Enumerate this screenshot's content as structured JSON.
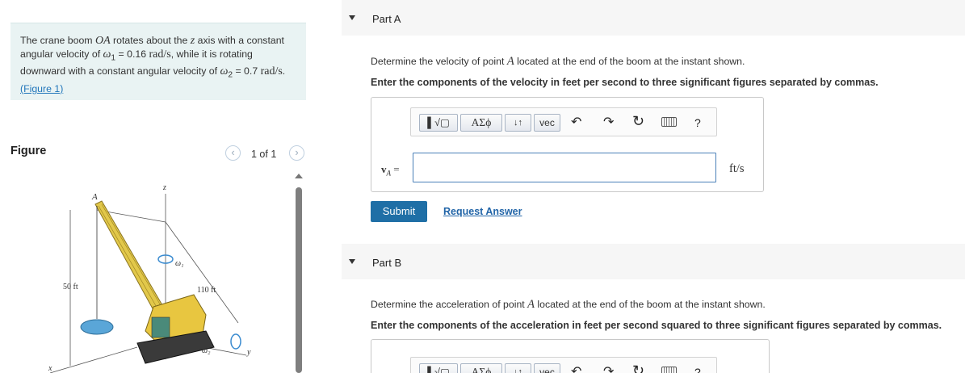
{
  "problem": {
    "text_1": "The crane boom ",
    "boom_var": "OA",
    "text_2": " rotates about the ",
    "axis_var": "z",
    "text_3": " axis with a constant angular velocity of ",
    "omega1_sym": "ω",
    "omega1_sub": "1",
    "omega1_eq": " = 0.16 ",
    "unit_1": "rad/s",
    "text_4": ", while it is rotating downward with a constant angular velocity of ",
    "omega2_sym": "ω",
    "omega2_sub": "2",
    "omega2_eq": " = 0.7 ",
    "unit_2": "rad/s",
    "text_5": ". ",
    "figure_link": "(Figure 1)"
  },
  "figure": {
    "title": "Figure",
    "pager": "1 of 1",
    "prev_icon": "chevron-left-icon",
    "next_icon": "chevron-right-icon",
    "labels": {
      "A": "A",
      "z": "z",
      "omega1": "ω₁",
      "omega2": "ω₂",
      "height": "50 ft",
      "length": "110 ft",
      "x": "x",
      "y": "y"
    }
  },
  "partA": {
    "title": "Part A",
    "question_1": "Determine the velocity of point ",
    "point": "A",
    "question_2": " located at the end of the boom at the instant shown.",
    "instruction": "Enter the components of the velocity in feet per second to three significant figures separated by commas.",
    "toolbar": {
      "templates": "▌√▢",
      "greek": "ΑΣϕ",
      "arrows": "↓↑",
      "vec": "vec",
      "undo_icon": "undo-icon",
      "redo_icon": "redo-icon",
      "reset_icon": "reset-icon",
      "keyboard_icon": "keyboard-icon",
      "help": "?"
    },
    "var_bold": "v",
    "var_sub": "A",
    "var_eq": " =",
    "input_value": "",
    "unit": "ft/s",
    "submit": "Submit",
    "request": "Request Answer"
  },
  "partB": {
    "title": "Part B",
    "question_1": "Determine the acceleration of point ",
    "point": "A",
    "question_2": " located at the end of the boom at the instant shown.",
    "instruction": "Enter the components of the acceleration in feet per second squared to three significant figures separated by commas.",
    "toolbar": {
      "templates": "▌√▢",
      "greek": "ΑΣϕ",
      "arrows": "↓↑",
      "vec": "vec",
      "help": "?"
    }
  },
  "colors": {
    "problem_bg": "#e9f3f3",
    "link": "#2277bb",
    "submit_bg": "#1f6fa6",
    "part_header_bg": "#f6f6f6",
    "input_border": "#4a80b8"
  }
}
